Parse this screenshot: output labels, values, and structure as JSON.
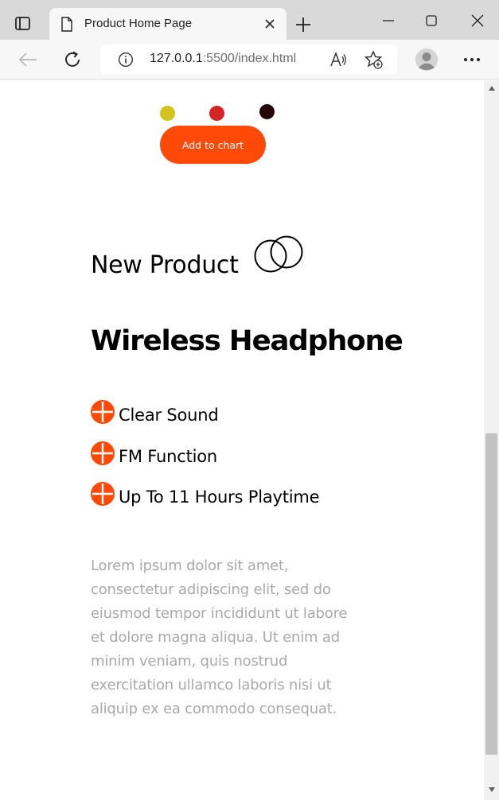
{
  "browser": {
    "tab_title": "Product Home Page",
    "url_host": "127.0.0.1",
    "url_rest": ":5500/index.html"
  },
  "product": {
    "colors": [
      "#d4c21e",
      "#d42424",
      "#250707"
    ],
    "add_button_label": "Add to chart",
    "kicker": "New Product",
    "title": "Wireless Headphone",
    "features": [
      "Clear Sound",
      "FM Function",
      "Up To 11 Hours Playtime"
    ],
    "description": "Lorem ipsum dolor sit amet, consectetur adipiscing elit, sed do eiusmod tempor incididunt ut labore et dolore magna aliqua. Ut enim ad minim veniam, quis nostrud exercitation ullamco laboris nisi ut aliquip ex ea commodo consequat.",
    "accent_color": "#fe4a06"
  },
  "icons": {
    "feature": "plus-circle-icon",
    "kicker": "overlapping-circles-icon"
  }
}
